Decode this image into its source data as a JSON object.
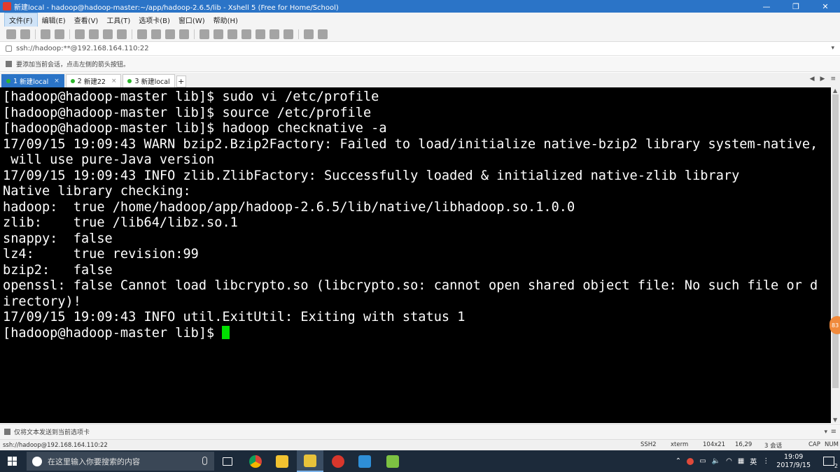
{
  "window": {
    "title": "新建local - hadoop@hadoop-master:~/app/hadoop-2.6.5/lib - Xshell 5 (Free for Home/School)",
    "controls": {
      "minimize": "—",
      "restore": "❐",
      "close": "✕"
    }
  },
  "menu": [
    {
      "label": "文件(F)"
    },
    {
      "label": "编辑(E)"
    },
    {
      "label": "查看(V)"
    },
    {
      "label": "工具(T)"
    },
    {
      "label": "选项卡(B)"
    },
    {
      "label": "窗口(W)"
    },
    {
      "label": "帮助(H)"
    }
  ],
  "address": {
    "text": "ssh://hadoop:**@192.168.164.110:22",
    "dropdown": "▾"
  },
  "hint": {
    "text": "要添加当前会话，点击左侧的箭头按钮。"
  },
  "tabs": [
    {
      "num": "1",
      "label": "新建local",
      "active": true,
      "close": "×"
    },
    {
      "num": "2",
      "label": "新建22",
      "active": false,
      "close": "×"
    },
    {
      "num": "3",
      "label": "新建local",
      "active": false,
      "close": ""
    }
  ],
  "tab_add": "+",
  "tab_nav": {
    "prev": "◀",
    "next": "▶",
    "menu": "≡"
  },
  "terminal": {
    "lines": [
      "[hadoop@hadoop-master lib]$ sudo vi /etc/profile",
      "[hadoop@hadoop-master lib]$ source /etc/profile",
      "[hadoop@hadoop-master lib]$ hadoop checknative -a",
      "17/09/15 19:09:43 WARN bzip2.Bzip2Factory: Failed to load/initialize native-bzip2 library system-native,",
      " will use pure-Java version",
      "17/09/15 19:09:43 INFO zlib.ZlibFactory: Successfully loaded & initialized native-zlib library",
      "Native library checking:",
      "hadoop:  true /home/hadoop/app/hadoop-2.6.5/lib/native/libhadoop.so.1.0.0",
      "zlib:    true /lib64/libz.so.1",
      "snappy:  false",
      "lz4:     true revision:99",
      "bzip2:   false",
      "openssl: false Cannot load libcrypto.so (libcrypto.so: cannot open shared object file: No such file or d",
      "irectory)!",
      "17/09/15 19:09:43 INFO util.ExitUtil: Exiting with status 1",
      "[hadoop@hadoop-master lib]$ "
    ]
  },
  "side_badge": "83",
  "compose": {
    "text": "仅将文本发送到当前选项卡",
    "dropdown": "▾",
    "menu": "≡"
  },
  "status": {
    "connection": "ssh://hadoop@192.168.164.110:22",
    "protocol": "SSH2",
    "term": "xterm",
    "size": "104x21",
    "pos": "16,29",
    "sessions": "3 会话",
    "caps": "CAP",
    "num": "NUM"
  },
  "taskbar": {
    "search_placeholder": "在这里输入你要搜索的内容",
    "ime": "英",
    "clock_time": "19:09",
    "clock_date": "2017/9/15",
    "notif_count": "2"
  }
}
